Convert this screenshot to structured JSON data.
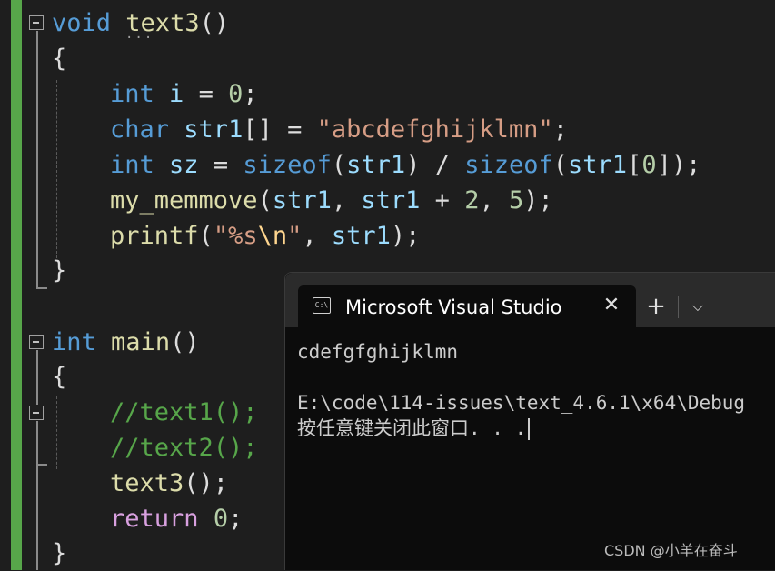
{
  "editor": {
    "lines": {
      "l1": {
        "kw": "void",
        "fn": "text3",
        "punc": "()"
      },
      "l2": {
        "brace": "{"
      },
      "l3": {
        "kw": "int",
        "var": "i",
        "op": " = ",
        "num": "0",
        "end": ";"
      },
      "l4": {
        "kw": "char",
        "var": "str1",
        "br": "[] = ",
        "str": "\"abcdefghijklmn\"",
        "end": ";"
      },
      "l5": {
        "kw": "int",
        "var": "sz",
        "op": " = ",
        "kw2": "sizeof",
        "p1": "(",
        "var2": "str1",
        "p2": ") / ",
        "kw3": "sizeof",
        "p3": "(",
        "var3": "str1",
        "p4": "[",
        "num": "0",
        "p5": "]);"
      },
      "l6": {
        "fn": "my_memmove",
        "p1": "(",
        "var1": "str1",
        "p2": ", ",
        "var2": "str1",
        "op": " + ",
        "num1": "2",
        "p3": ", ",
        "num2": "5",
        "p4": ");"
      },
      "l7": {
        "fn": "printf",
        "p1": "(",
        "str1": "\"%s",
        "esc": "\\n",
        "str2": "\"",
        "p2": ", ",
        "var": "str1",
        "p3": ");"
      },
      "l8": {
        "brace": "}"
      },
      "l9": {
        "kw": "int",
        "fn": "main",
        "punc": "()"
      },
      "l10": {
        "brace": "{"
      },
      "l11": {
        "cmt": "//text1();"
      },
      "l12": {
        "cmt": "//text2();"
      },
      "l13": {
        "fn": "text3",
        "punc": "();"
      },
      "l14": {
        "ctl": "return",
        "num": "0",
        "end": ";"
      },
      "l15": {
        "brace": "}"
      }
    }
  },
  "console": {
    "tab_title": "Microsoft Visual Studio",
    "tab_icon_text": "C:\\",
    "close_glyph": "✕",
    "newtab_glyph": "+",
    "dropdown_glyph": "⌵",
    "output": [
      "cdefgfghijklmn",
      "",
      "E:\\code\\114-issues\\text_4.6.1\\x64\\Debug",
      "按任意键关闭此窗口. . ."
    ]
  },
  "watermark": "CSDN @小羊在奋斗"
}
